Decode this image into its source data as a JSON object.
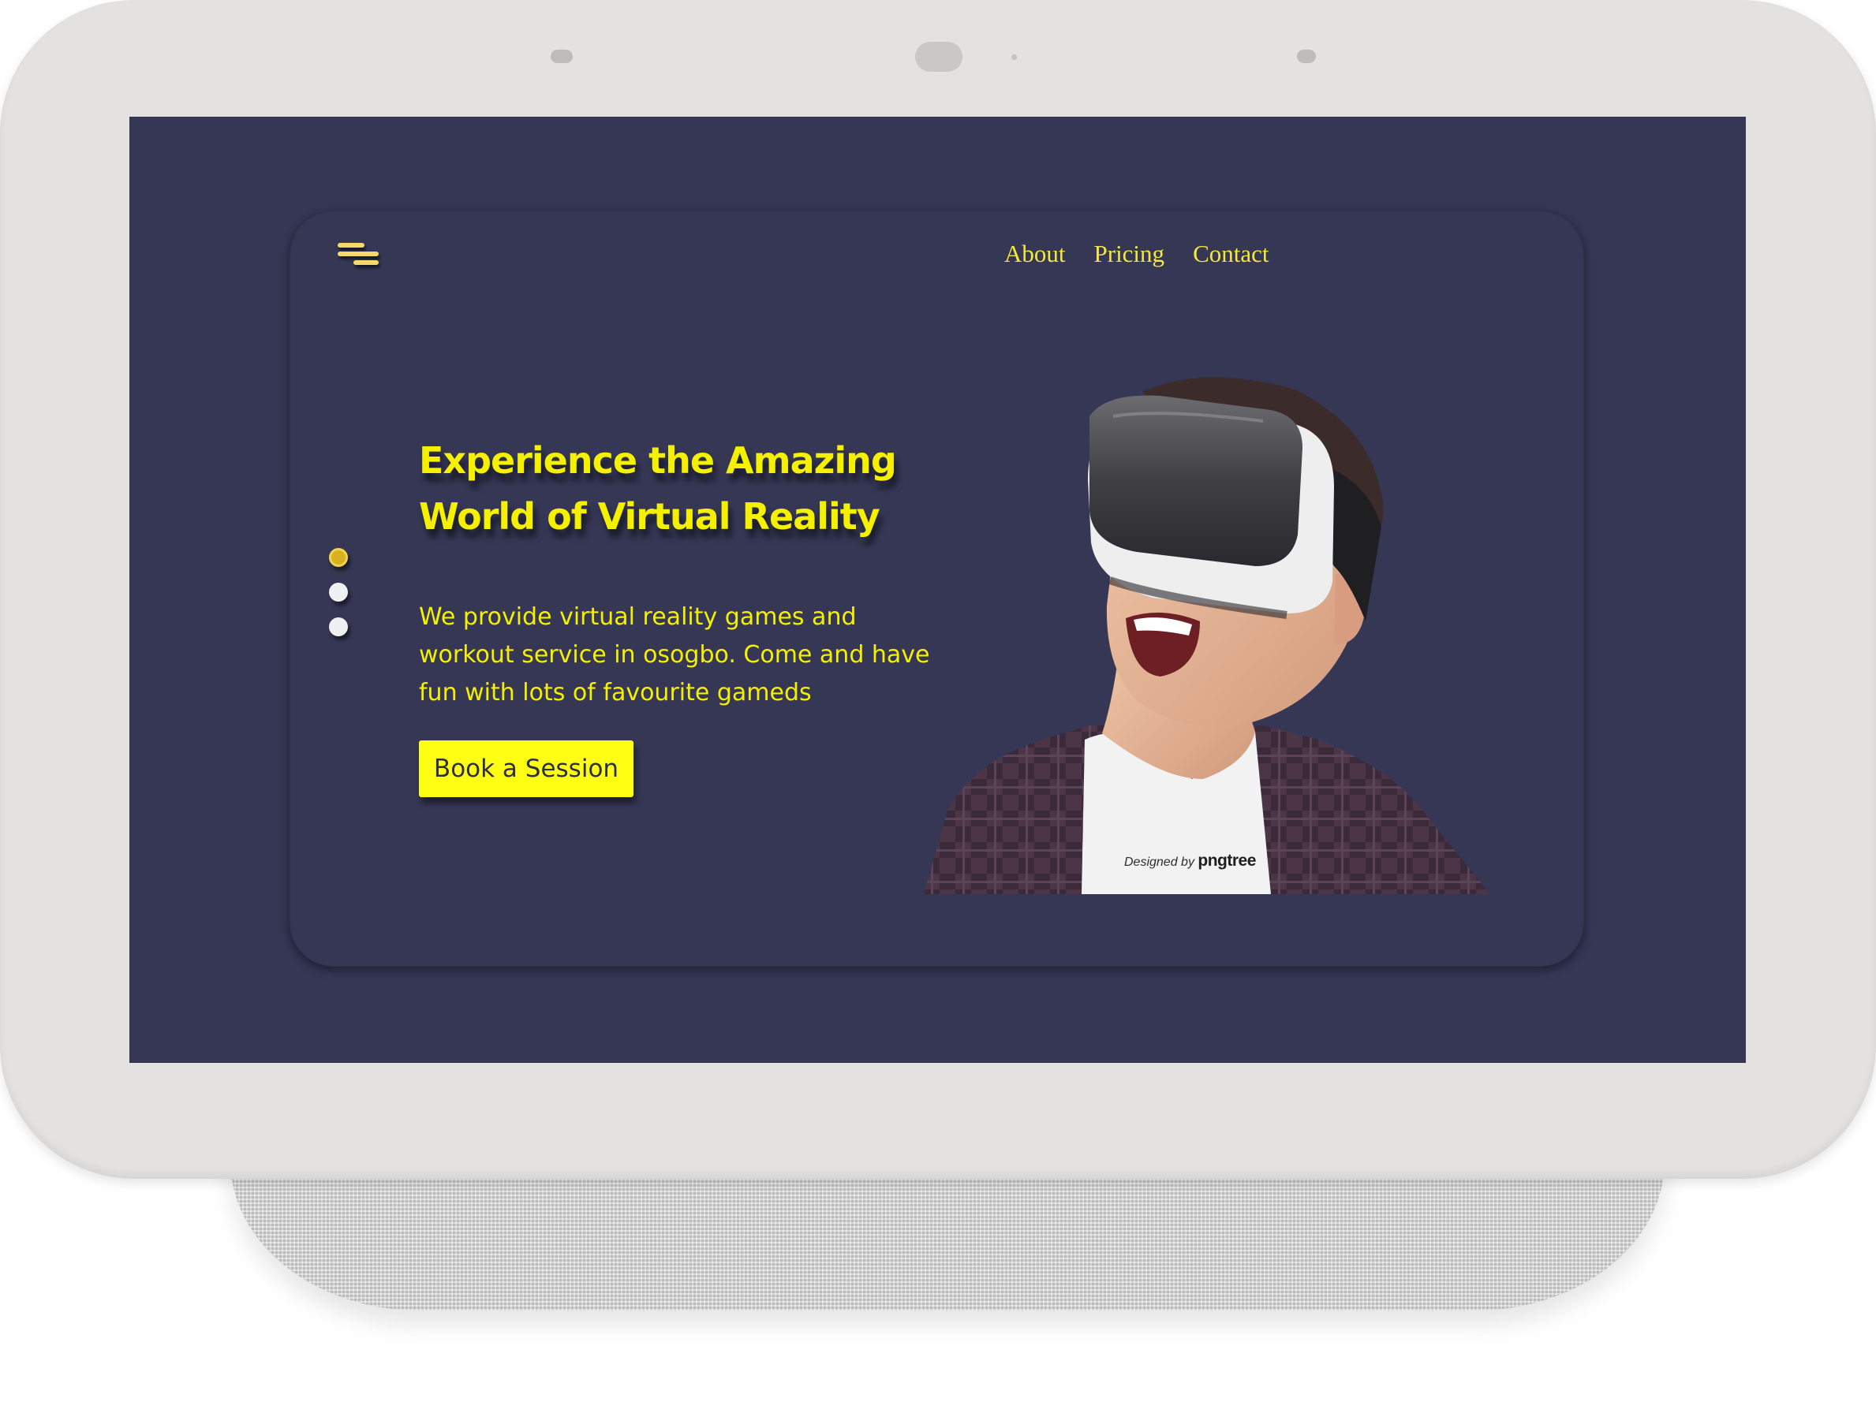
{
  "nav": {
    "items": [
      {
        "label": "About"
      },
      {
        "label": "Pricing"
      },
      {
        "label": "Contact"
      }
    ]
  },
  "hero": {
    "headline_line1": "Experience the Amazing",
    "headline_line2": "World of Virtual Reality",
    "description": "We provide virtual reality games and workout service in osogbo. Come and have fun with lots of favourite gameds",
    "cta_label": "Book a Session",
    "slides": {
      "count": 3,
      "active_index": 0
    }
  },
  "image": {
    "watermark_prefix": "Designed by",
    "watermark_brand": "pngtree"
  },
  "colors": {
    "screen_bg": "#353755",
    "accent_yellow": "#f4f000",
    "nav_text": "#f5e83a",
    "button_bg": "#ffff14",
    "button_text": "#2e2f45",
    "device_bezel": "#e3e2e0"
  },
  "icons": {
    "menu": "hamburger-menu-icon"
  }
}
